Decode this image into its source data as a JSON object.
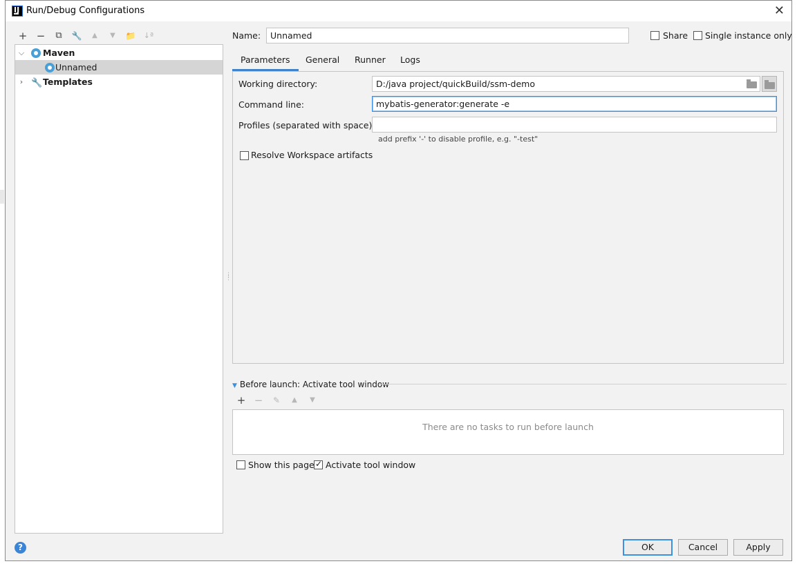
{
  "window": {
    "title": "Run/Debug Configurations"
  },
  "toolbar": {
    "add": "+",
    "remove": "−",
    "copy": "⧉",
    "edit": "🔧",
    "up": "▲",
    "down": "▼",
    "folder": "📁",
    "sort": "↓ª"
  },
  "tree": {
    "items": [
      {
        "label": "Maven",
        "expanded": true,
        "bold": true,
        "icon": "maven-gear-icon"
      },
      {
        "label": "Unnamed",
        "selected": true,
        "icon": "maven-gear-icon"
      },
      {
        "label": "Templates",
        "expanded": false,
        "bold": true,
        "icon": "wrench-icon"
      }
    ]
  },
  "name_field": {
    "label": "Name:",
    "value": "Unnamed"
  },
  "share": {
    "label": "Share",
    "checked": false
  },
  "single_instance": {
    "label": "Single instance only",
    "checked": false
  },
  "tabs": [
    "Parameters",
    "General",
    "Runner",
    "Logs"
  ],
  "active_tab": "Parameters",
  "parameters": {
    "working_dir_label": "Working directory:",
    "working_dir_value": "D:/java project/quickBuild/ssm-demo",
    "command_line_label": "Command line:",
    "command_line_value": "mybatis-generator:generate -e",
    "profiles_label": "Profiles (separated with space):",
    "profiles_value": "",
    "profiles_hint": "add prefix '-' to disable profile, e.g. \"-test\"",
    "resolve_label": "Resolve Workspace artifacts",
    "resolve_checked": false
  },
  "before_launch": {
    "title": "Before launch: Activate tool window",
    "empty_text": "There are no tasks to run before launch"
  },
  "show_page": {
    "label": "Show this page",
    "checked": false
  },
  "activate_tool": {
    "label": "Activate tool window",
    "checked": true
  },
  "buttons": {
    "ok": "OK",
    "cancel": "Cancel",
    "apply": "Apply",
    "help": "?"
  },
  "colors": {
    "accent": "#3d8fe0",
    "selection": "#d5d5d5",
    "background": "#f2f2f2"
  }
}
